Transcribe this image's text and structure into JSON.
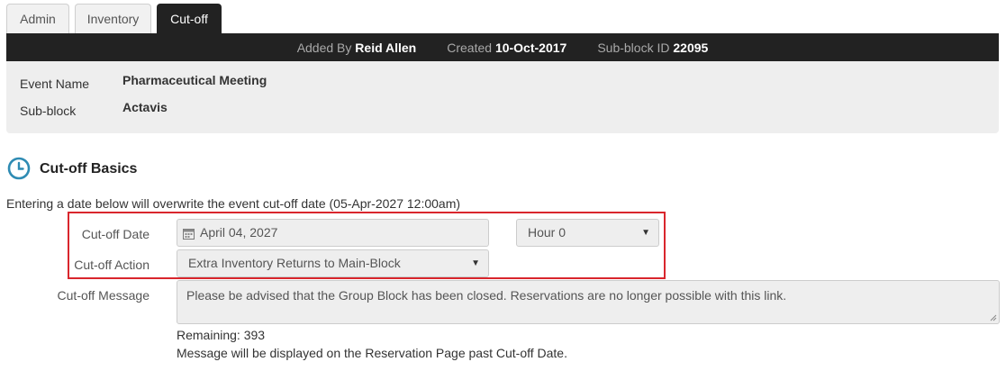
{
  "tabs": [
    {
      "label": "Admin"
    },
    {
      "label": "Inventory"
    },
    {
      "label": "Cut-off"
    }
  ],
  "infobar": {
    "added_by_label": "Added By",
    "added_by_value": "Reid Allen",
    "created_label": "Created",
    "created_value": "10-Oct-2017",
    "subblock_id_label": "Sub-block ID",
    "subblock_id_value": "22095"
  },
  "info_panel": {
    "event_name_label": "Event Name",
    "event_name_value": "Pharmaceutical Meeting",
    "subblock_label": "Sub-block",
    "subblock_value": "Actavis"
  },
  "section": {
    "icon": "clock-icon",
    "title": "Cut-off Basics",
    "intro": "Entering a date below will overwrite the event cut-off date (05-Apr-2027 12:00am)"
  },
  "form": {
    "cutoff_date_label": "Cut-off Date",
    "cutoff_date_value": "April 04, 2027",
    "hour_value": "Hour 0",
    "cutoff_action_label": "Cut-off Action",
    "cutoff_action_value": "Extra Inventory Returns to Main-Block",
    "cutoff_message_label": "Cut-off Message",
    "cutoff_message_value": "Please be advised that the Group Block has been closed. Reservations are no longer possible with this link.",
    "remaining_text": "Remaining: 393",
    "message_note": "Message will be displayed on the Reservation Page past Cut-off Date."
  },
  "colors": {
    "dark_bar": "#222222",
    "panel_bg": "#eeeeee",
    "highlight_border": "#d9262d",
    "icon_teal": "#2e8bb3"
  }
}
